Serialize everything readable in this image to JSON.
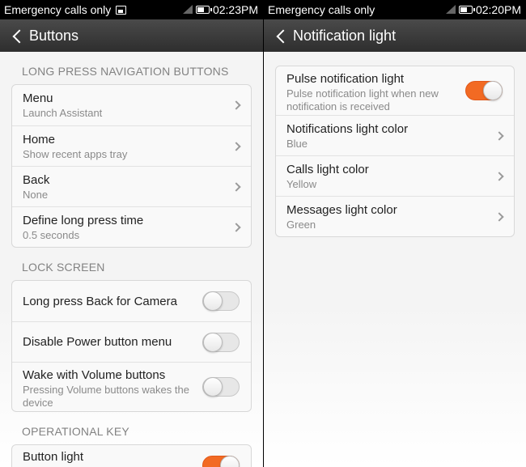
{
  "left": {
    "status": {
      "left_text": "Emergency calls only",
      "time": "02:23PM"
    },
    "title": "Buttons",
    "sections": [
      {
        "header": "LONG PRESS NAVIGATION BUTTONS",
        "items": [
          {
            "title": "Menu",
            "subtitle": "Launch Assistant"
          },
          {
            "title": "Home",
            "subtitle": "Show recent apps tray"
          },
          {
            "title": "Back",
            "subtitle": "None"
          },
          {
            "title": "Define long press time",
            "subtitle": "0.5 seconds"
          }
        ]
      },
      {
        "header": "LOCK SCREEN",
        "items": [
          {
            "title": "Long press Back for Camera",
            "enabled": false
          },
          {
            "title": "Disable Power button menu",
            "enabled": false
          },
          {
            "title": "Wake with Volume buttons",
            "subtitle": "Pressing Volume buttons wakes the device",
            "enabled": false
          }
        ]
      },
      {
        "header": "OPERATIONAL KEY",
        "items": [
          {
            "title": "Button light",
            "enabled": true
          }
        ]
      }
    ]
  },
  "right": {
    "status": {
      "left_text": "Emergency calls only",
      "time": "02:20PM"
    },
    "title": "Notification light",
    "items": [
      {
        "title": "Pulse notification light",
        "subtitle": "Pulse notification light when new notification is received",
        "enabled": true
      },
      {
        "title": "Notifications light color",
        "subtitle": "Blue"
      },
      {
        "title": "Calls light color",
        "subtitle": "Yellow"
      },
      {
        "title": "Messages light color",
        "subtitle": "Green"
      }
    ]
  },
  "colors": {
    "accent": "#f26a23",
    "titlebar": "#3a3a3a",
    "statusbar": "#000000"
  }
}
